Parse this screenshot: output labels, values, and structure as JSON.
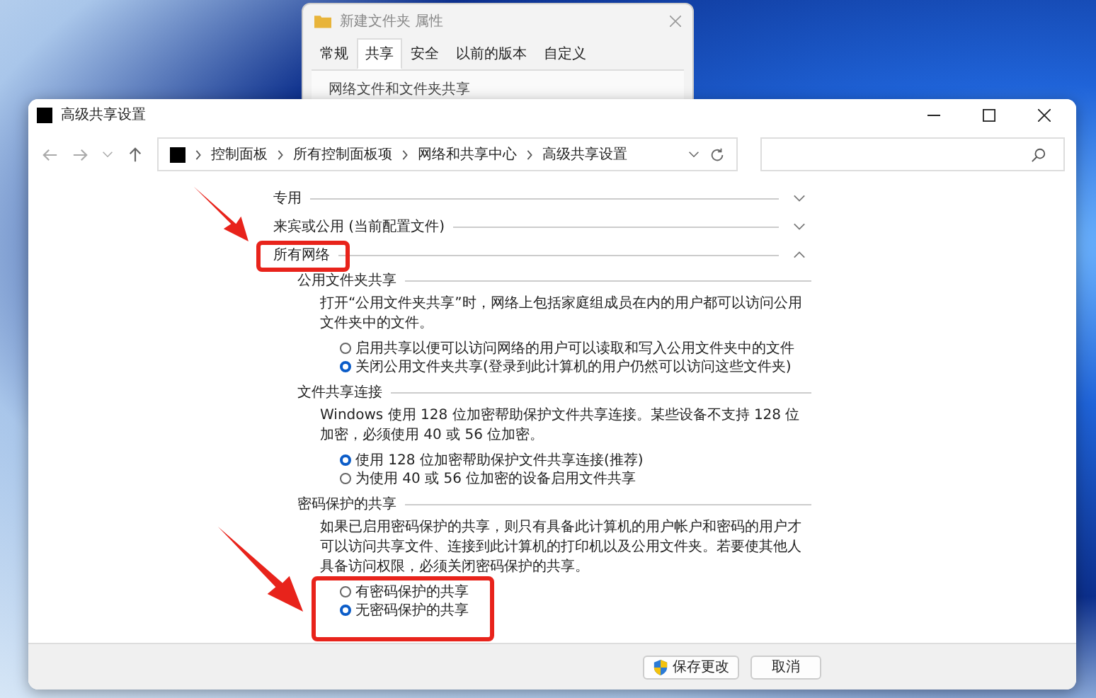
{
  "background_window": {
    "title": "新建文件夹 属性",
    "tabs": [
      {
        "label": "常规",
        "selected": false
      },
      {
        "label": "共享",
        "selected": true
      },
      {
        "label": "安全",
        "selected": false
      },
      {
        "label": "以前的版本",
        "selected": false
      },
      {
        "label": "自定义",
        "selected": false
      }
    ],
    "group_title": "网络文件和文件夹共享"
  },
  "window": {
    "title": "高级共享设置"
  },
  "address_bar": {
    "breadcrumbs": [
      "控制面板",
      "所有控制面板项",
      "网络和共享中心",
      "高级共享设置"
    ]
  },
  "profiles": [
    {
      "label": "专用",
      "expanded": false
    },
    {
      "label": "来宾或公用 (当前配置文件)",
      "expanded": false
    },
    {
      "label": "所有网络",
      "expanded": true,
      "sections": [
        {
          "title": "公用文件夹共享",
          "description": "打开“公用文件夹共享”时，网络上包括家庭组成员在内的用户都可以访问公用文件夹中的文件。",
          "options": [
            {
              "label": "启用共享以便可以访问网络的用户可以读取和写入公用文件夹中的文件",
              "selected": false
            },
            {
              "label": "关闭公用文件夹共享(登录到此计算机的用户仍然可以访问这些文件夹)",
              "selected": true
            }
          ]
        },
        {
          "title": "文件共享连接",
          "description": "Windows 使用 128 位加密帮助保护文件共享连接。某些设备不支持 128 位加密，必须使用 40 或 56 位加密。",
          "options": [
            {
              "label": "使用 128 位加密帮助保护文件共享连接(推荐)",
              "selected": true
            },
            {
              "label": "为使用 40 或 56 位加密的设备启用文件共享",
              "selected": false
            }
          ]
        },
        {
          "title": "密码保护的共享",
          "description": "如果已启用密码保护的共享，则只有具备此计算机的用户帐户和密码的用户才可以访问共享文件、连接到此计算机的打印机以及公用文件夹。若要使其他人具备访问权限，必须关闭密码保护的共享。",
          "options": [
            {
              "label": "有密码保护的共享",
              "selected": false
            },
            {
              "label": "无密码保护的共享",
              "selected": true
            }
          ]
        }
      ]
    }
  ],
  "buttons": [
    {
      "label": "保存更改",
      "kind": "shield"
    },
    {
      "label": "取消",
      "kind": "plain"
    }
  ]
}
